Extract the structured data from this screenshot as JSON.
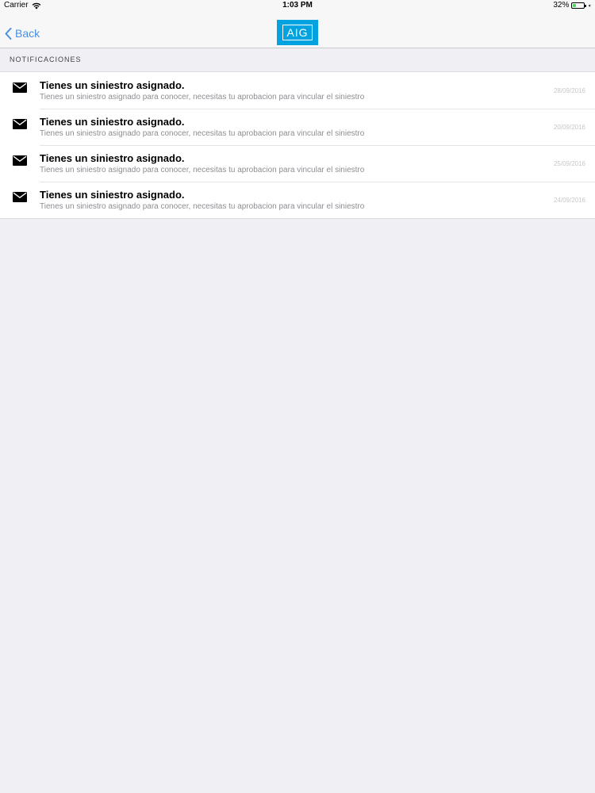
{
  "status_bar": {
    "carrier": "Carrier",
    "time": "1:03 PM",
    "battery_level": "32%",
    "battery_fraction": 0.32
  },
  "nav": {
    "back_label": "Back",
    "logo_text": "AIG",
    "logo_color": "#00a3e0",
    "accent_color": "#4a90e2"
  },
  "section": {
    "title": "NOTIFICACIONES"
  },
  "notifications": [
    {
      "title": "Tienes un siniestro asignado.",
      "subtitle": "Tienes un siniestro asignado para conocer, necesitas tu aprobacion para vincular el siniestro",
      "date": "28/09/2016",
      "icon": "envelope-icon"
    },
    {
      "title": "Tienes un siniestro asignado.",
      "subtitle": "Tienes un siniestro asignado para conocer, necesitas tu aprobacion para vincular el siniestro",
      "date": "20/09/2016",
      "icon": "envelope-icon"
    },
    {
      "title": "Tienes un siniestro asignado.",
      "subtitle": "Tienes un siniestro asignado para conocer, necesitas tu aprobacion para vincular el siniestro",
      "date": "25/09/2016",
      "icon": "envelope-icon"
    },
    {
      "title": "Tienes un siniestro asignado.",
      "subtitle": "Tienes un siniestro asignado para conocer, necesitas tu aprobacion para vincular el siniestro",
      "date": "24/09/2016",
      "icon": "envelope-icon"
    }
  ]
}
